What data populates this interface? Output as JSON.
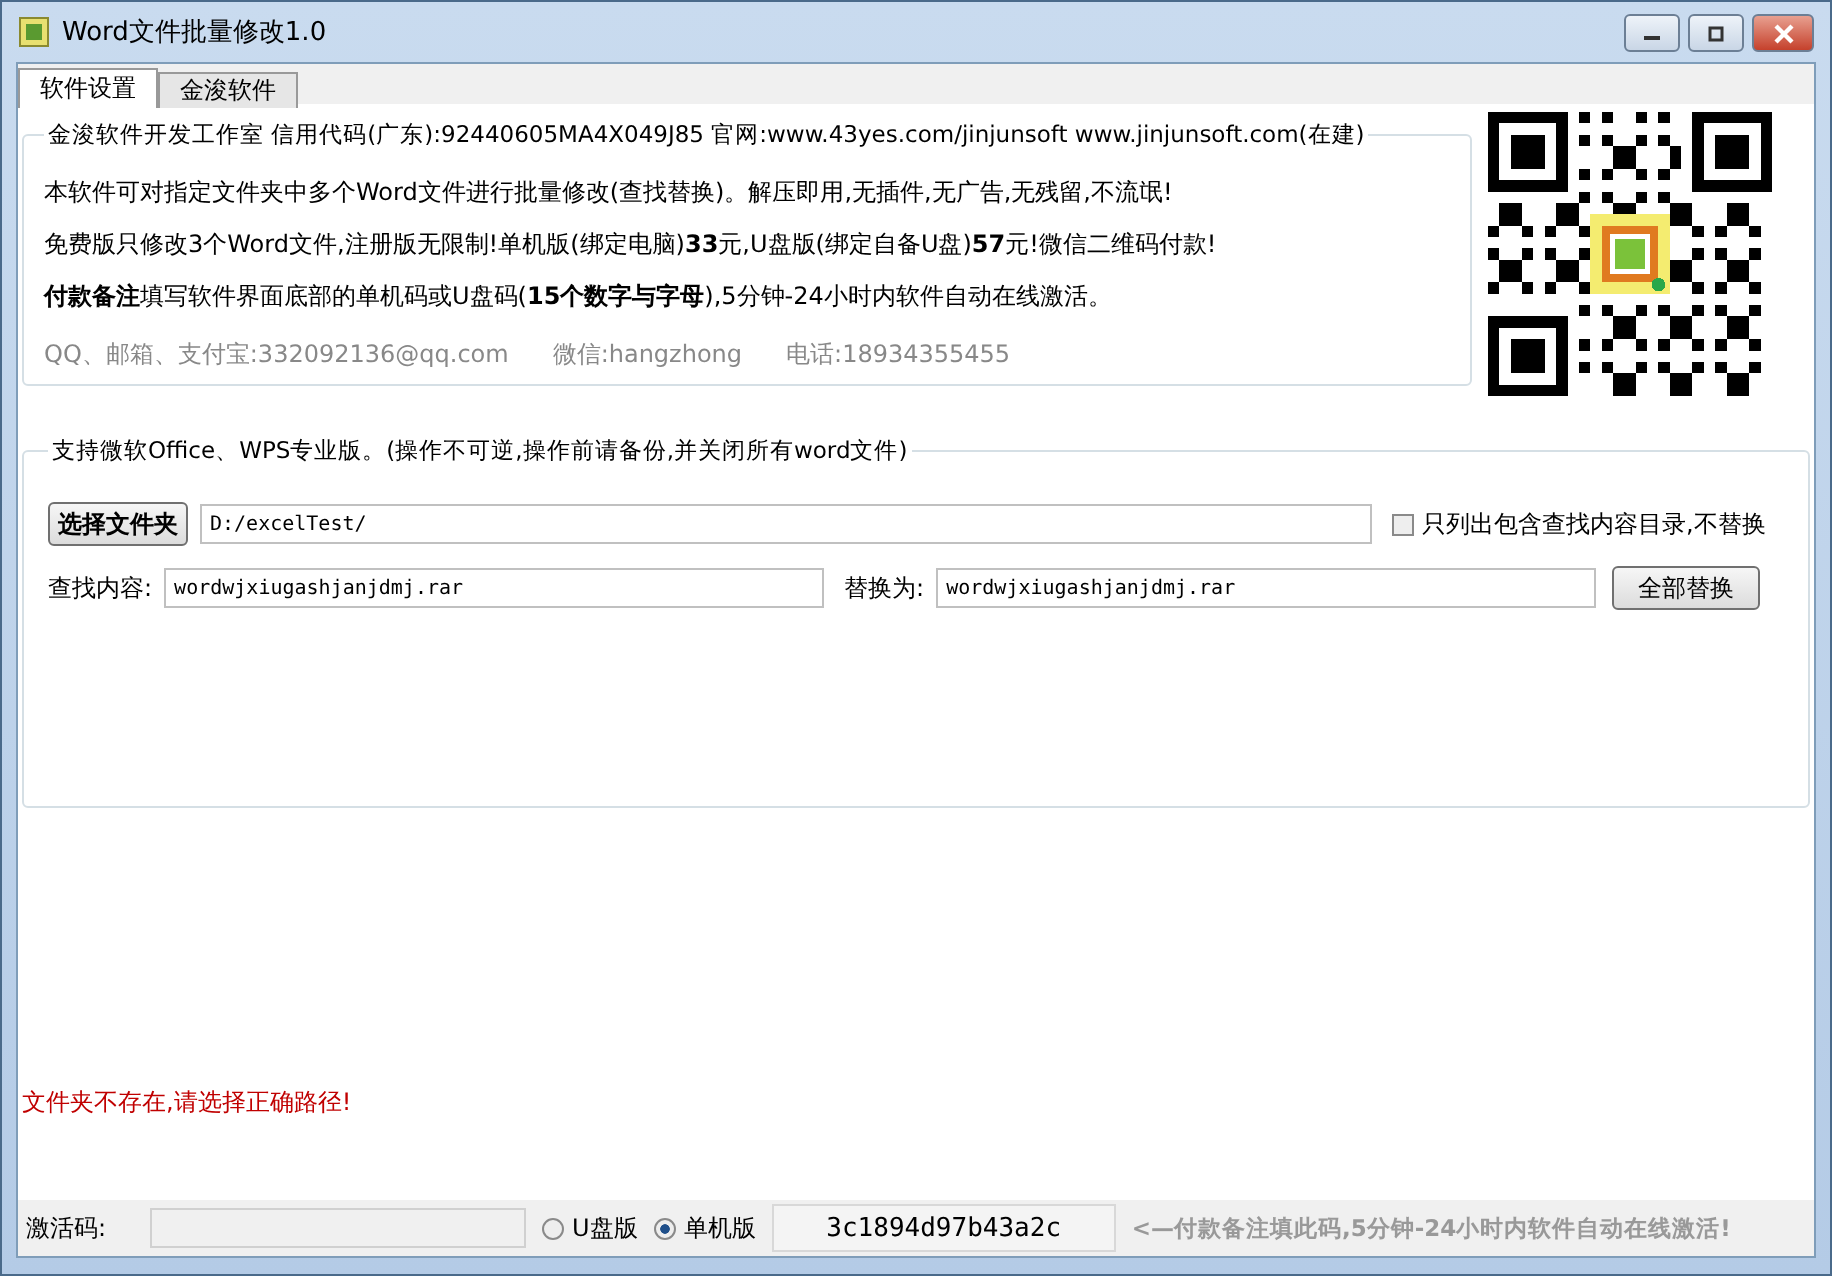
{
  "window": {
    "title": "Word文件批量修改1.0"
  },
  "tabs": [
    {
      "label": "软件设置",
      "selected": true
    },
    {
      "label": "金浚软件",
      "selected": false
    }
  ],
  "info": {
    "legend": "金浚软件开发工作室 信用代码(广东):92440605MA4X049J85 官网:www.43yes.com/jinjunsoft  www.jinjunsoft.com(在建)",
    "lines": [
      "本软件可对指定文件夹中多个Word文件进行批量修改(查找替换)。解压即用,无插件,无广告,无残留,不流氓!",
      "免费版只修改3个Word文件,注册版无限制!单机版(绑定电脑)**33**元,U盘版(绑定自备U盘)**57**元!微信二维码付款!",
      "**付款备注**填写软件界面底部的单机码或U盘码(**15个数字与字母**),5分钟-24小时内软件自动在线激活。"
    ],
    "contacts": [
      "QQ、邮箱、支付宝:332092136@qq.com",
      "微信:hangzhong",
      "电话:18934355455"
    ]
  },
  "settings": {
    "legend": "支持微软Office、WPS专业版。(操作不可逆,操作前请备份,并关闭所有word文件)",
    "folder_button": "选择文件夹",
    "folder_path": "D:/excelTest/",
    "list_only": {
      "label": "只列出包含查找内容目录,不替换",
      "checked": false
    },
    "find_label": "查找内容:",
    "find_value": "wordwjxiugashjanjdmj.rar",
    "replace_label": "替换为:",
    "replace_value": "wordwjxiugashjanjdmj.rar",
    "replace_button": "全部替换"
  },
  "message": "文件夹不存在,请选择正确路径!",
  "status_bar": {
    "activation_label": "激活码:",
    "editions": [
      {
        "label": "U盘版",
        "selected": false
      },
      {
        "label": "单机版",
        "selected": true
      }
    ],
    "machine_code": "3c1894d97b43a2c",
    "hint": "<—付款备注填此码,5分钟-24小时内软件自动在线激活!"
  }
}
